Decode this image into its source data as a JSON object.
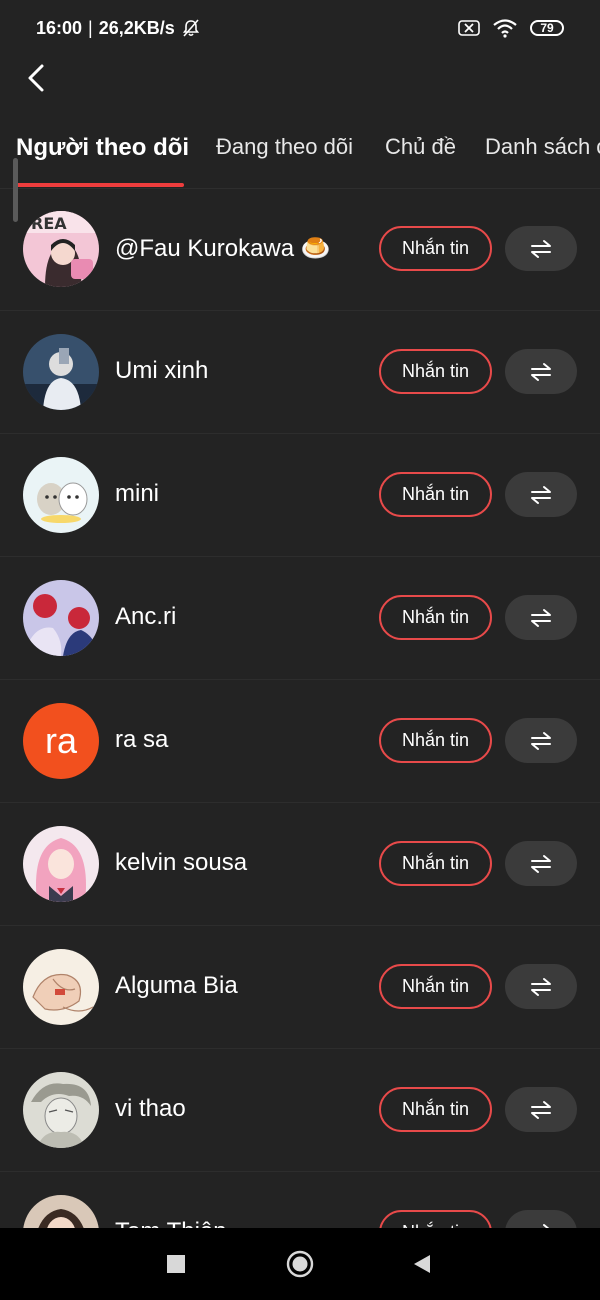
{
  "status": {
    "time": "16:00",
    "speed": "26,2KB/s",
    "battery": "79"
  },
  "tabs": [
    {
      "label": "Người theo dõi",
      "active": true
    },
    {
      "label": "Đang theo dõi",
      "active": false
    },
    {
      "label": "Chủ đề",
      "active": false
    },
    {
      "label": "Danh sách c",
      "active": false
    }
  ],
  "colors": {
    "background": "#232323",
    "accent": "#ee3d3d",
    "button_gray": "#3b3b3b"
  },
  "list": {
    "items": [
      {
        "name": "@Fau Kurokawa 🍮",
        "message_label": "Nhắn tin",
        "swap_icon": "swap-arrows-icon"
      },
      {
        "name": "Umi xinh",
        "message_label": "Nhắn tin",
        "swap_icon": "swap-arrows-icon"
      },
      {
        "name": "mini",
        "message_label": "Nhắn tin",
        "swap_icon": "swap-arrows-icon"
      },
      {
        "name": "Anc.ri",
        "message_label": "Nhắn tin",
        "swap_icon": "swap-arrows-icon"
      },
      {
        "name": "ra sa",
        "avatar_text": "ra",
        "avatar_color": "#f2501e",
        "message_label": "Nhắn tin",
        "swap_icon": "swap-arrows-icon"
      },
      {
        "name": "kelvin sousa",
        "message_label": "Nhắn tin",
        "swap_icon": "swap-arrows-icon"
      },
      {
        "name": "Alguma Bia",
        "message_label": "Nhắn tin",
        "swap_icon": "swap-arrows-icon"
      },
      {
        "name": "vi thao",
        "message_label": "Nhắn tin",
        "swap_icon": "swap-arrows-icon"
      },
      {
        "name": "Tom Thiện",
        "message_label": "Nhắn tin",
        "swap_icon": "swap-arrows-icon"
      }
    ]
  },
  "nav": {
    "recent_icon": "square-icon",
    "home_icon": "circle-home-icon",
    "back_icon": "triangle-back-icon"
  }
}
